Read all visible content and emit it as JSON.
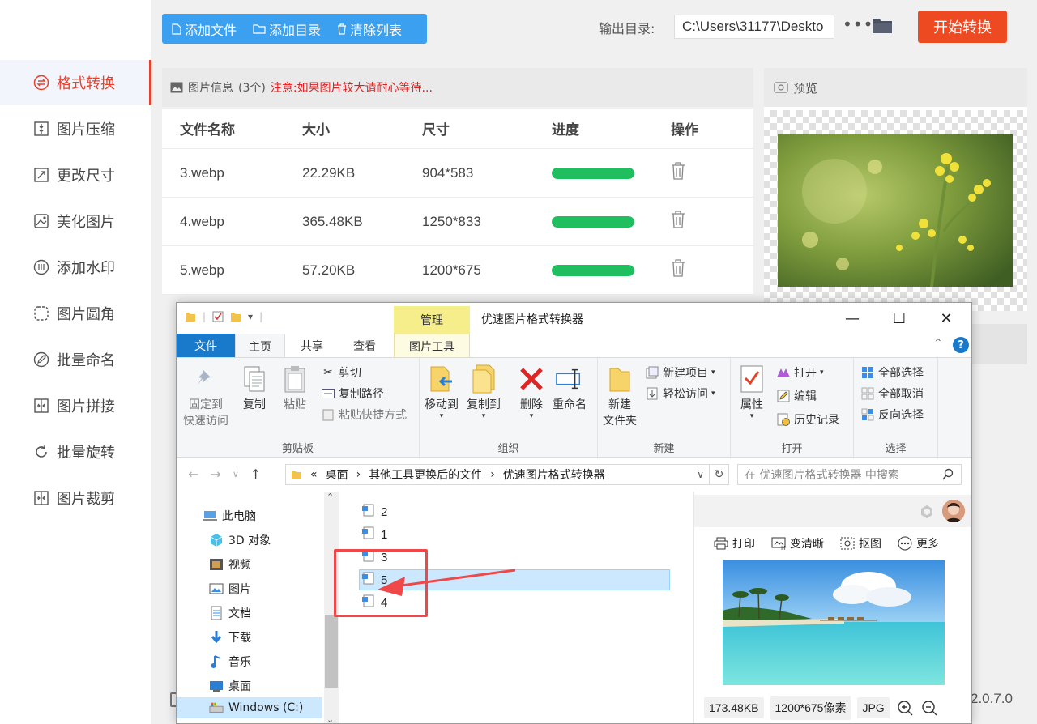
{
  "app": {
    "sidebar": [
      {
        "label": "格式转换",
        "icon": "format-convert-icon",
        "active": true
      },
      {
        "label": "图片压缩",
        "icon": "compress-icon"
      },
      {
        "label": "更改尺寸",
        "icon": "resize-icon"
      },
      {
        "label": "美化图片",
        "icon": "beautify-icon"
      },
      {
        "label": "添加水印",
        "icon": "watermark-icon"
      },
      {
        "label": "图片圆角",
        "icon": "rounded-corner-icon"
      },
      {
        "label": "批量命名",
        "icon": "rename-icon"
      },
      {
        "label": "图片拼接",
        "icon": "stitch-icon"
      },
      {
        "label": "批量旋转",
        "icon": "rotate-icon"
      },
      {
        "label": "图片裁剪",
        "icon": "crop-icon"
      }
    ],
    "toolbar": {
      "add_file": "添加文件",
      "add_dir": "添加目录",
      "clear_list": "清除列表"
    },
    "output": {
      "label": "输出目录:",
      "path": "C:\\Users\\31177\\Deskto",
      "more": "•••"
    },
    "start_button": "开始转换",
    "info": {
      "title": "图片信息",
      "count": "(3个)",
      "notice": "注意:如果图片较大请耐心等待..."
    },
    "table": {
      "headers": [
        "文件名称",
        "大小",
        "尺寸",
        "进度",
        "操作"
      ],
      "rows": [
        {
          "name": "3.webp",
          "size": "22.29KB",
          "dims": "904*583",
          "progress": 1.0
        },
        {
          "name": "4.webp",
          "size": "365.48KB",
          "dims": "1250*833",
          "progress": 1.0
        },
        {
          "name": "5.webp",
          "size": "57.20KB",
          "dims": "1200*675",
          "progress": 1.0
        }
      ]
    },
    "preview_title": "预览",
    "version": "2.0.7.0",
    "colors": {
      "accent": "#e8402a",
      "blue": "#3ca0f0",
      "progress": "#1fbf5f",
      "start": "#ee4a22"
    }
  },
  "explorer": {
    "manage_tab": "管理",
    "title": "优速图片格式转换器",
    "controls": {
      "minimize": "—",
      "maximize": "☐",
      "close": "✕"
    },
    "tabs": {
      "file": "文件",
      "home": "主页",
      "share": "共享",
      "view": "查看",
      "picture_tools": "图片工具"
    },
    "ribbon": {
      "clipboard": {
        "name": "剪贴板",
        "pin": "固定到\n快速访问",
        "copy": "复制",
        "paste": "粘贴",
        "cut": "剪切",
        "copy_path": "复制路径",
        "paste_shortcut": "粘贴快捷方式"
      },
      "organize": {
        "name": "组织",
        "move_to": "移动到",
        "copy_to": "复制到",
        "delete": "删除",
        "rename": "重命名"
      },
      "new": {
        "name": "新建",
        "new_folder": "新建\n文件夹",
        "new_item": "新建项目",
        "easy_access": "轻松访问"
      },
      "open": {
        "name": "打开",
        "properties": "属性",
        "open": "打开",
        "edit": "编辑",
        "history": "历史记录"
      },
      "select": {
        "name": "选择",
        "select_all": "全部选择",
        "select_none": "全部取消",
        "invert": "反向选择"
      }
    },
    "address": {
      "sep": "«",
      "parts": [
        "桌面",
        "其他工具更换后的文件",
        "优速图片格式转换器"
      ]
    },
    "search_placeholder": "在 优速图片格式转换器 中搜索",
    "nav": [
      {
        "label": "此电脑",
        "icon": "this-pc-icon"
      },
      {
        "label": "3D 对象",
        "icon": "3d-objects-icon"
      },
      {
        "label": "视频",
        "icon": "video-icon"
      },
      {
        "label": "图片",
        "icon": "pictures-icon"
      },
      {
        "label": "文档",
        "icon": "documents-icon"
      },
      {
        "label": "下载",
        "icon": "download-icon"
      },
      {
        "label": "音乐",
        "icon": "music-icon"
      },
      {
        "label": "桌面",
        "icon": "desktop-icon"
      },
      {
        "label": "Windows (C:)",
        "icon": "drive-icon",
        "selected": true
      }
    ],
    "files": [
      {
        "name": "2"
      },
      {
        "name": "1"
      },
      {
        "name": "3"
      },
      {
        "name": "5",
        "selected": true
      },
      {
        "name": "4"
      }
    ],
    "preview": {
      "toolbar": {
        "print": "打印",
        "sharpen": "变清晰",
        "cutout": "抠图",
        "more": "更多"
      },
      "file_size": "173.48KB",
      "dims": "1200*675像素",
      "format": "JPG"
    }
  }
}
